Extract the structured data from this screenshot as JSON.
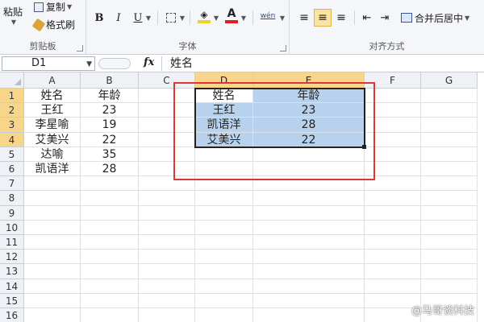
{
  "ribbon": {
    "clipboard": {
      "paste_label": "粘贴",
      "copy_label": "复制",
      "format_painter_label": "格式刷",
      "group_label": "剪贴板"
    },
    "font": {
      "bold": "B",
      "italic": "I",
      "underline": "U",
      "font_color_glyph": "A",
      "phonetic_glyph": "wén",
      "group_label": "字体",
      "fill_color": "#f2d21a",
      "font_color": "#e02020"
    },
    "alignment": {
      "merge_center_label": "合并后居中",
      "group_label": "对齐方式"
    }
  },
  "formula_bar": {
    "name_box": "D1",
    "fx": "fx",
    "formula": "姓名"
  },
  "grid": {
    "columns": [
      "A",
      "B",
      "C",
      "D",
      "E",
      "F",
      "G"
    ],
    "selected_columns": [
      "D",
      "E"
    ],
    "rows": [
      "1",
      "2",
      "3",
      "4",
      "5",
      "6",
      "7",
      "8",
      "9",
      "10",
      "11",
      "12",
      "13",
      "14",
      "15",
      "16"
    ],
    "selected_rows": [
      "1",
      "2",
      "3",
      "4"
    ],
    "source_table": [
      [
        "姓名",
        "年龄"
      ],
      [
        "王红",
        "23"
      ],
      [
        "李星喻",
        "19"
      ],
      [
        "艾美兴",
        "22"
      ],
      [
        "达喻",
        "35"
      ],
      [
        "凯语洋",
        "28"
      ]
    ],
    "result_table": [
      [
        "姓名",
        "年龄"
      ],
      [
        "王红",
        "23"
      ],
      [
        "凯语洋",
        "28"
      ],
      [
        "艾美兴",
        "22"
      ]
    ],
    "highlight_color": "#b8d2ee",
    "annotation_color": "#e03535"
  },
  "watermark": "@马哥谈科技"
}
